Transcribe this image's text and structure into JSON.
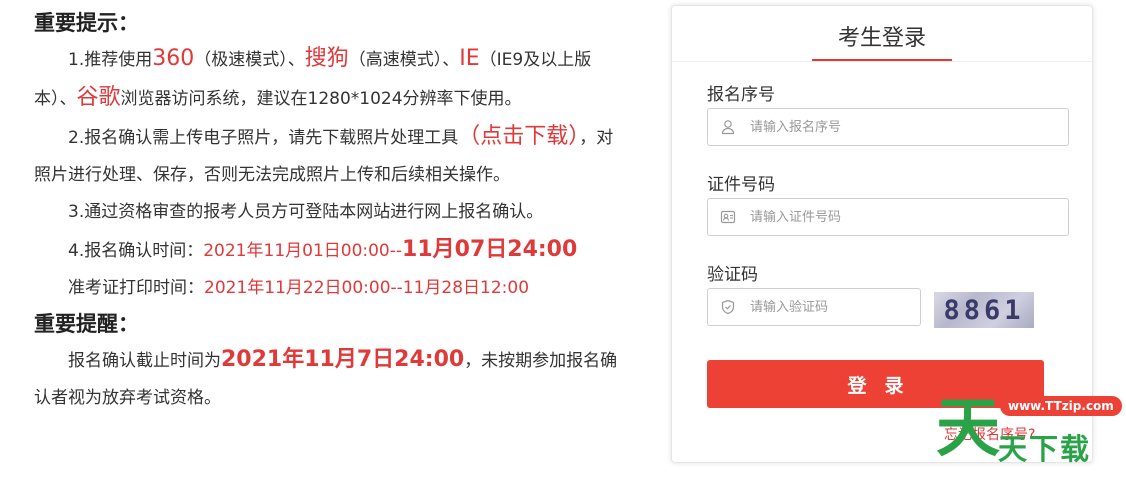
{
  "notice": {
    "title": "重要提示：",
    "p1": {
      "t1": "1.推荐使用",
      "b360": "360",
      "t2": "（极速模式）、",
      "sougou": "搜狗",
      "t3": "（高速模式）、",
      "ie": "IE",
      "t4": "（IE9及以上版本）、",
      "guge": "谷歌",
      "t5": "浏览器访问系统，建议在1280*1024分辨率下使用。"
    },
    "p2": {
      "t1": "2.报名确认需上传电子照片，请先下载照片处理工具",
      "link": "（点击下载）",
      "t2": "，对照片进行处理、保存，否则无法完成照片上传和后续相关操作。"
    },
    "p3": "3.通过资格审查的报考人员方可登陆本网站进行网上报名确认。",
    "p4": {
      "label": "4.报名确认时间：",
      "start": "2021年11月01日00:00--",
      "end": "11月07日24:00"
    },
    "p5": {
      "label": "准考证打印时间：",
      "range": "2021年11月22日00:00--11月28日12:00"
    }
  },
  "reminder": {
    "title": "重要提醒：",
    "t1": "报名确认截止时间为",
    "deadline": "2021年11月7日24:00",
    "t2": "，未按期参加报名确认者视为放弃考试资格。"
  },
  "login": {
    "title": "考生登录",
    "reg_label": "报名序号",
    "reg_placeholder": "请输入报名序号",
    "id_label": "证件号码",
    "id_placeholder": "请输入证件号码",
    "captcha_label": "验证码",
    "captcha_placeholder": "请输入验证码",
    "captcha_code": "8861",
    "button": "登录",
    "link": "忘记报名序号?"
  },
  "watermark": {
    "site": "www.TTzip.com",
    "big": "天",
    "small": "天下载"
  },
  "colors": {
    "accent": "#ed4136",
    "text_red": "#e0393a",
    "watermark_green": "#2aa348"
  }
}
